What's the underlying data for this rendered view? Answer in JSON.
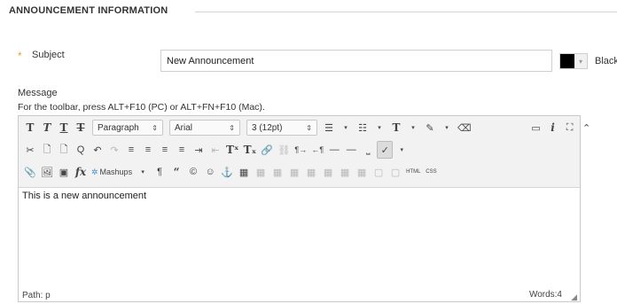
{
  "section": {
    "title": "ANNOUNCEMENT INFORMATION"
  },
  "subject": {
    "required_marker": "*",
    "label": "Subject",
    "value": "New Announcement"
  },
  "color": {
    "value": "#000000",
    "name": "Black",
    "dropdown_icon": "chevron-down-icon"
  },
  "message": {
    "label": "Message",
    "toolbar_hint": "For the toolbar, press ALT+F10 (PC) or ALT+FN+F10 (Mac)."
  },
  "toolbar": {
    "row1": {
      "text_styles": [
        "T",
        "T",
        "T",
        "T"
      ],
      "format": "Paragraph",
      "font": "Arial",
      "size": "3 (12pt)",
      "text_color_glyph": "T",
      "highlight_glyph": "✎",
      "eraser_glyph": "⌫",
      "preview_glyph": "▭",
      "info_glyph": "i",
      "fullscreen_glyph": "⛶",
      "collapse_glyph": "⌃"
    },
    "row2": {
      "cut": "✂",
      "copy": "🗋",
      "paste": "🗋",
      "find": "Q",
      "undo": "↶",
      "redo": "↷",
      "align_left": "≡",
      "align_center": "≡",
      "align_right": "≡",
      "justify": "≡",
      "indent": "⇥",
      "outdent": "⇤",
      "superscript": "Tˣ",
      "subscript": "Tₓ",
      "link": "🔗",
      "unlink": "⛓",
      "ltr": "¶→",
      "rtl": "←¶",
      "hr": "—",
      "hr2": "—",
      "nbsp": "⎵",
      "spellcheck": "✓"
    },
    "row3": {
      "attach": "📎",
      "image": "🖼",
      "media": "▣",
      "formula": "fx",
      "mashups": "Mashups",
      "pilcrow": "¶",
      "quote": "“",
      "copyright": "©",
      "emoji": "☺",
      "anchor": "⚓",
      "html": "HTML",
      "css": "CSS"
    }
  },
  "editor": {
    "content": "This is a new announcement",
    "path": "Path: p",
    "words": "Words:4"
  }
}
